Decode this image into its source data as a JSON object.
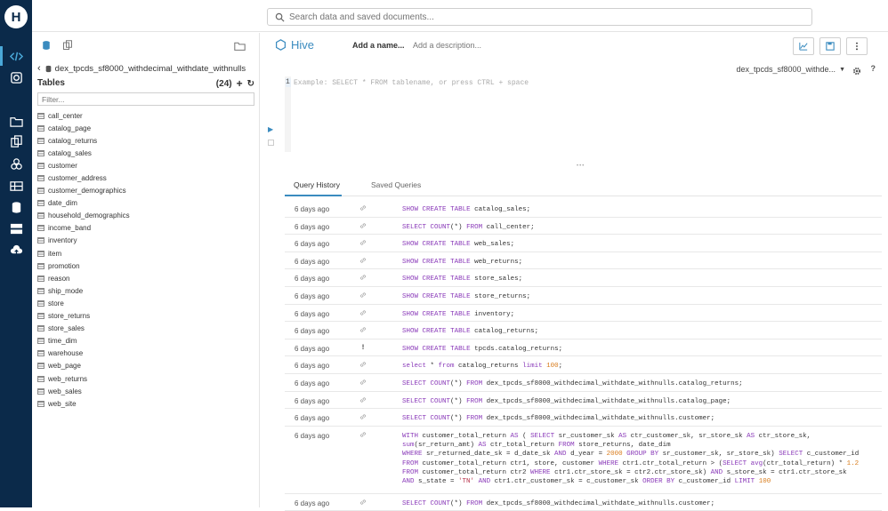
{
  "topbar": {
    "search_placeholder": "Search data and saved documents..."
  },
  "left_panel": {
    "database": "dex_tpcds_sf8000_withdecimal_withdate_withnulls",
    "tables_label": "Tables",
    "tables_count": "(24)",
    "filter_placeholder": "Filter...",
    "tables": [
      "call_center",
      "catalog_page",
      "catalog_returns",
      "catalog_sales",
      "customer",
      "customer_address",
      "customer_demographics",
      "date_dim",
      "household_demographics",
      "income_band",
      "inventory",
      "item",
      "promotion",
      "reason",
      "ship_mode",
      "store",
      "store_returns",
      "store_sales",
      "time_dim",
      "warehouse",
      "web_page",
      "web_returns",
      "web_sales",
      "web_site"
    ]
  },
  "editor": {
    "app_name": "Hive",
    "add_name": "Add a name...",
    "add_description": "Add a description...",
    "selected_database": "dex_tpcds_sf8000_withde...",
    "line_number": "1",
    "placeholder": "Example: SELECT * FROM tablename, or press CTRL + space"
  },
  "tabs": [
    "Query History",
    "Saved Queries"
  ],
  "history": [
    {
      "time": "6 days ago",
      "status": "link-icon",
      "sql": "SHOW CREATE TABLE catalog_sales;"
    },
    {
      "time": "6 days ago",
      "status": "link-icon",
      "sql": "SELECT COUNT(*) FROM call_center;"
    },
    {
      "time": "6 days ago",
      "status": "link-icon",
      "sql": "SHOW CREATE TABLE web_sales;"
    },
    {
      "time": "6 days ago",
      "status": "link-icon",
      "sql": "SHOW CREATE TABLE web_returns;"
    },
    {
      "time": "6 days ago",
      "status": "link-icon",
      "sql": "SHOW CREATE TABLE store_sales;"
    },
    {
      "time": "6 days ago",
      "status": "link-icon",
      "sql": "SHOW CREATE TABLE store_returns;"
    },
    {
      "time": "6 days ago",
      "status": "link-icon",
      "sql": "SHOW CREATE TABLE inventory;"
    },
    {
      "time": "6 days ago",
      "status": "link-icon",
      "sql": "SHOW CREATE TABLE catalog_returns;"
    },
    {
      "time": "6 days ago",
      "status": "!",
      "sql": "SHOW CREATE TABLE tpcds.catalog_returns;"
    },
    {
      "time": "6 days ago",
      "status": "link-icon",
      "sql": "select * from catalog_returns limit 100;"
    },
    {
      "time": "6 days ago",
      "status": "link-icon",
      "sql": "SELECT COUNT(*) FROM dex_tpcds_sf8000_withdecimal_withdate_withnulls.catalog_returns;"
    },
    {
      "time": "6 days ago",
      "status": "link-icon",
      "sql": "SELECT COUNT(*) FROM dex_tpcds_sf8000_withdecimal_withdate_withnulls.catalog_page;"
    },
    {
      "time": "6 days ago",
      "status": "link-icon",
      "sql": "SELECT COUNT(*) FROM dex_tpcds_sf8000_withdecimal_withdate_withnulls.customer;"
    },
    {
      "time": "6 days ago",
      "status": "link-icon",
      "sql": "WITH customer_total_return AS ( SELECT sr_customer_sk AS ctr_customer_sk, sr_store_sk AS ctr_store_sk,\nsum(sr_return_amt) AS ctr_total_return FROM store_returns, date_dim\nWHERE sr_returned_date_sk = d_date_sk AND d_year = 2000 GROUP BY sr_customer_sk, sr_store_sk) SELECT c_customer_id\nFROM customer_total_return ctr1, store, customer WHERE ctr1.ctr_total_return > (SELECT avg(ctr_total_return) * 1.2\nFROM customer_total_return ctr2 WHERE ctr1.ctr_store_sk = ctr2.ctr_store_sk) AND s_store_sk = ctr1.ctr_store_sk\nAND s_state = 'TN' AND ctr1.ctr_customer_sk = c_customer_sk ORDER BY c_customer_id LIMIT 100"
    },
    {
      "time": "6 days ago",
      "status": "link-icon",
      "sql": "SELECT COUNT(*) FROM dex_tpcds_sf8000_withdecimal_withdate_withnulls.customer;"
    }
  ],
  "colors": {
    "nav_bg": "#0b2a4a",
    "accent": "#3a8bbf",
    "keyword": "#8a3ab9",
    "number": "#d87b1a"
  }
}
